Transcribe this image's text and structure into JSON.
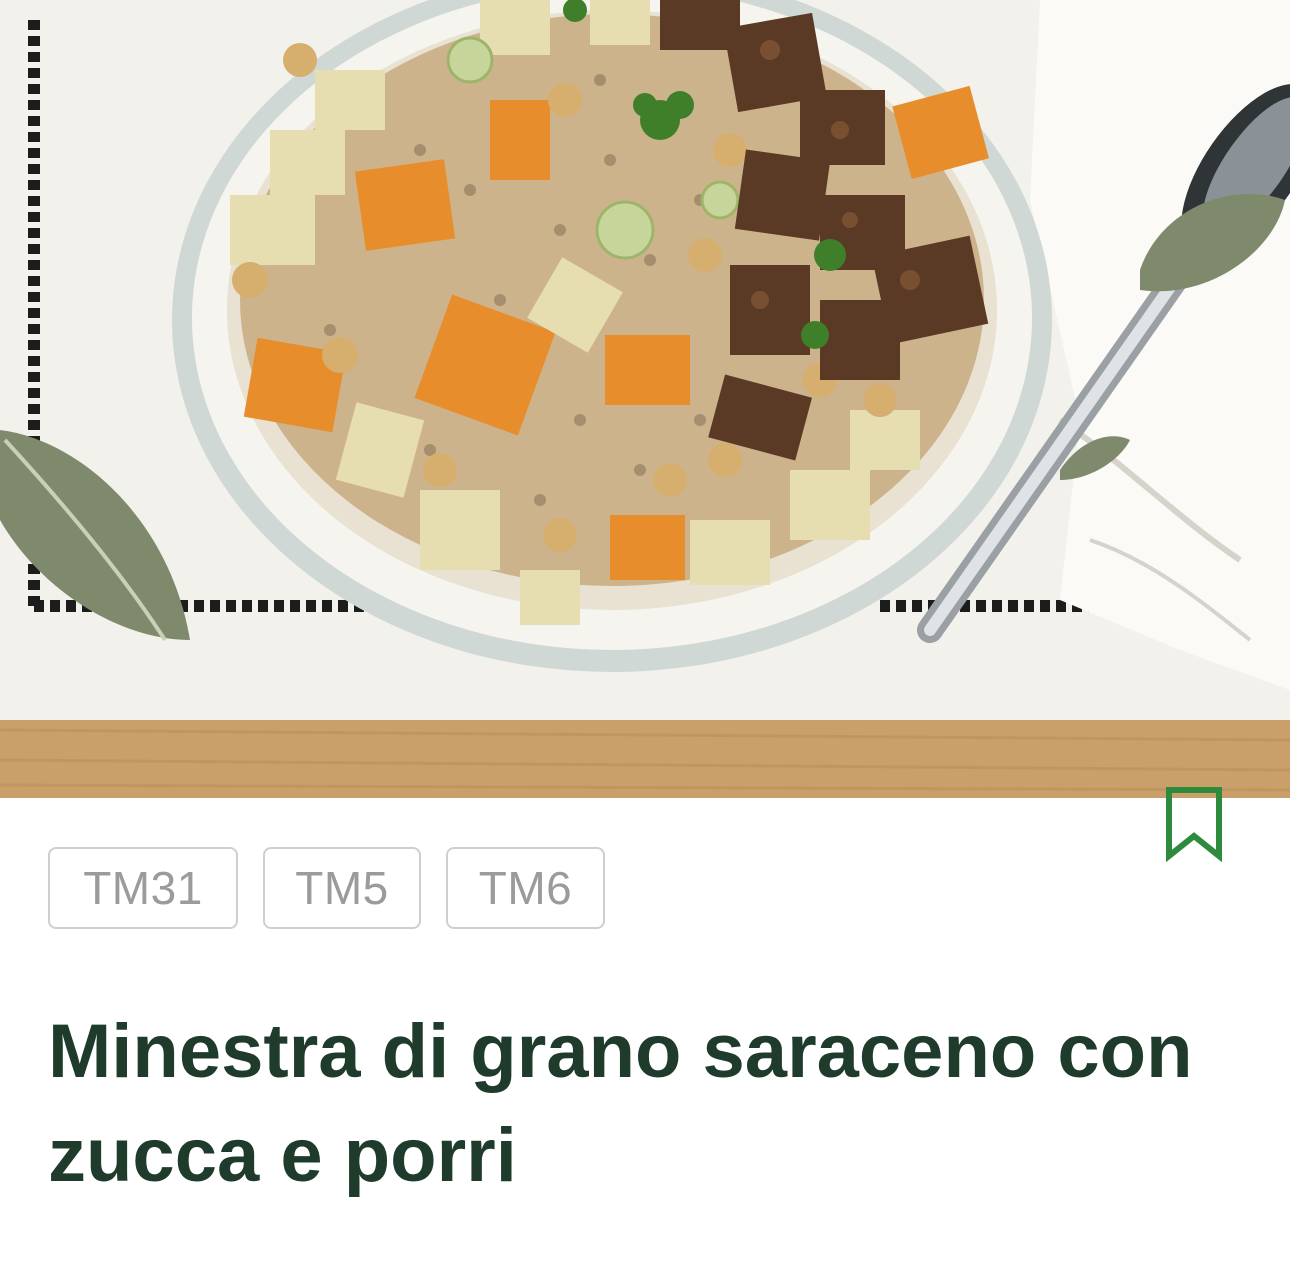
{
  "recipe": {
    "image_alt": "Minestra di grano saraceno con zucca e porri",
    "devices": [
      "TM31",
      "TM5",
      "TM6"
    ],
    "title": "Minestra di grano saraceno con zucca e porri",
    "bookmarked": false
  },
  "icons": {
    "bookmark": "bookmark-outline-icon"
  },
  "colors": {
    "accent": "#2e8b3e",
    "title": "#1f3b2b",
    "chip_text": "#9b9b9b",
    "chip_border": "#cfcfcf"
  }
}
